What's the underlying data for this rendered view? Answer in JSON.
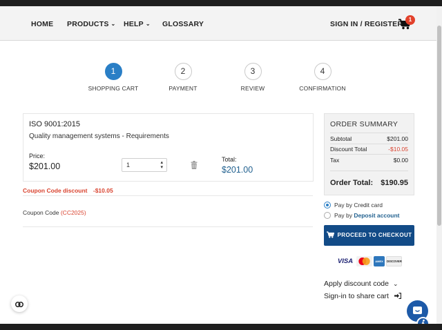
{
  "nav": {
    "home": "HOME",
    "products": "PRODUCTS",
    "help": "HELP",
    "glossary": "GLOSSARY",
    "sign_in": "SIGN IN / REGISTER",
    "cart_count": "1"
  },
  "steps": [
    {
      "number": "1",
      "label": "SHOPPING CART",
      "active": true
    },
    {
      "number": "2",
      "label": "PAYMENT",
      "active": false
    },
    {
      "number": "3",
      "label": "REVIEW",
      "active": false
    },
    {
      "number": "4",
      "label": "CONFIRMATION",
      "active": false
    }
  ],
  "cart_item": {
    "code": "ISO 9001:2015",
    "title": "Quality management systems - Requirements",
    "price_label": "Price:",
    "price": "$201.00",
    "quantity": "1",
    "total_label": "Total:",
    "total": "$201.00"
  },
  "coupon": {
    "discount_label": "Coupon Code discount",
    "discount_amount": "-$10.05",
    "code_label": "Coupon Code",
    "code": "(CC2025)"
  },
  "summary": {
    "title": "ORDER SUMMARY",
    "subtotal_label": "Subtotal",
    "subtotal": "$201.00",
    "discount_label": "Discount Total",
    "discount": "-$10.05",
    "tax_label": "Tax",
    "tax": "$0.00",
    "total_label": "Order Total:",
    "total": "$190.95"
  },
  "payment": {
    "credit_card": "Pay by Credit card",
    "deposit_prefix": "Pay by",
    "deposit_link": "Deposit account",
    "selected": "credit_card"
  },
  "checkout_button": "PROCEED TO CHECKOUT",
  "cards": [
    "VISA",
    "mastercard",
    "AMEX",
    "DISCOVER"
  ],
  "apply_discount": "Apply discount code",
  "share_cart": "Sign-in to share cart",
  "colors": {
    "accent": "#2a7fc6",
    "button": "#124b87",
    "discount": "#d9432f",
    "badge": "#e2412b"
  }
}
